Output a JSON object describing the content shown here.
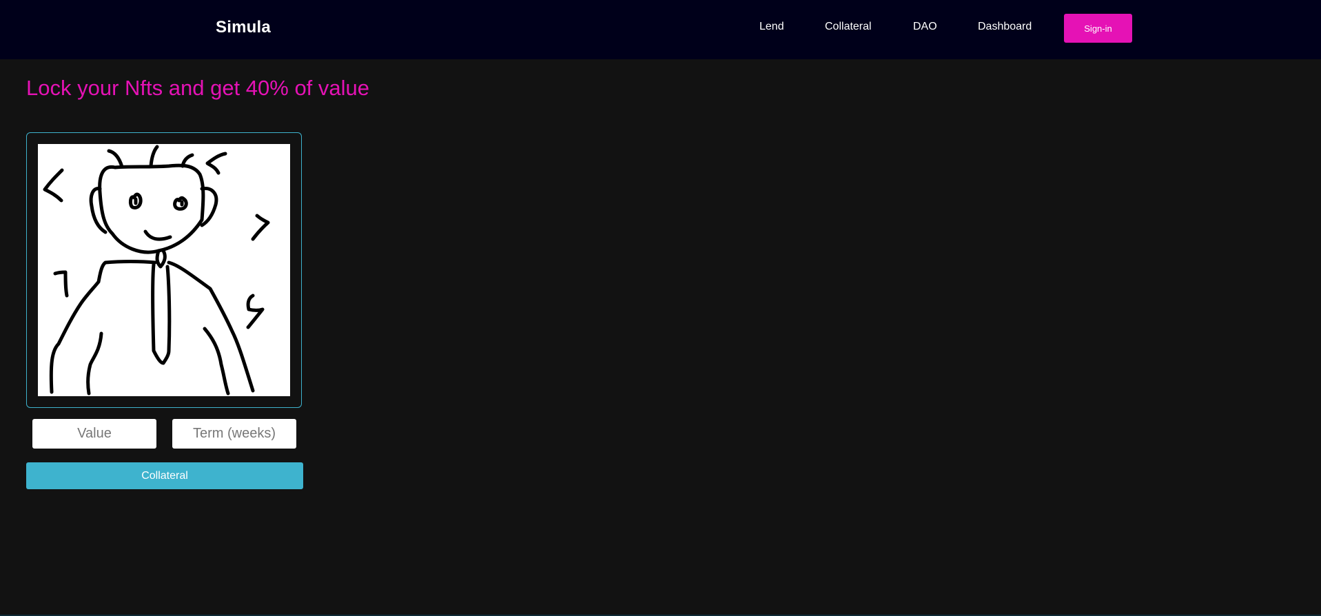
{
  "header": {
    "brand": "Simula",
    "nav": {
      "lend": "Lend",
      "collateral": "Collateral",
      "dao": "DAO",
      "dashboard": "Dashboard"
    },
    "signin_label": "Sign-in"
  },
  "main": {
    "title": "Lock your Nfts and get 40% of value",
    "nft": {
      "alt": "doodle robot nft"
    },
    "value_placeholder": "Value",
    "term_placeholder": "Term (weeks)",
    "collateral_button": "Collateral"
  },
  "colors": {
    "navbar_bg": "#00001a",
    "page_bg": "#121212",
    "accent_pink": "#e512b5",
    "accent_cyan": "#3eb3ce"
  }
}
